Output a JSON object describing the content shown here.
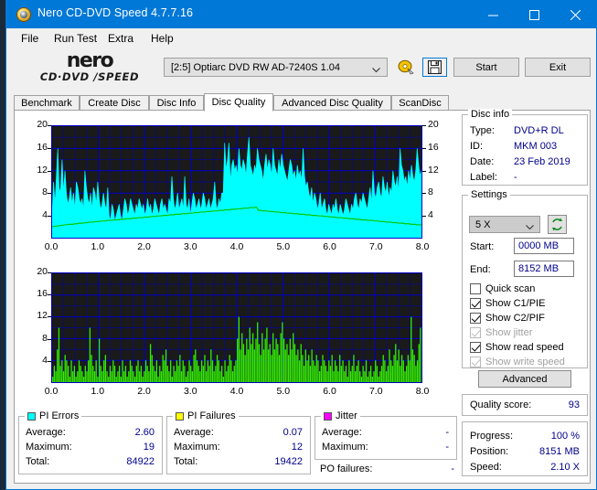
{
  "window": {
    "title": "Nero CD-DVD Speed 4.7.7.16",
    "icon": "nero-disc-icon",
    "minimize": "minimize-icon",
    "maximize": "maximize-icon",
    "close": "close-icon"
  },
  "menu": [
    {
      "label": "File"
    },
    {
      "label": "Run Test"
    },
    {
      "label": "Extra"
    },
    {
      "label": "Help"
    }
  ],
  "logo": {
    "line1": "nero",
    "line2": "CD·DVD ∕SPEED"
  },
  "toolbar": {
    "drive_value": "[2:5]   Optiarc DVD RW AD-7240S 1.04",
    "dropdown_icon": "chevron-down-icon",
    "disc_button_icon": "disc-eject-icon",
    "save_button_icon": "floppy-save-icon",
    "start_label": "Start",
    "exit_label": "Exit"
  },
  "tabs": [
    {
      "label": "Benchmark",
      "active": false
    },
    {
      "label": "Create Disc",
      "active": false
    },
    {
      "label": "Disc Info",
      "active": false
    },
    {
      "label": "Disc Quality",
      "active": true
    },
    {
      "label": "Advanced Disc Quality",
      "active": false
    },
    {
      "label": "ScanDisc",
      "active": false
    }
  ],
  "disc_info": {
    "title": "Disc info",
    "type_label": "Type:",
    "type_value": "DVD+R DL",
    "id_label": "ID:",
    "id_value": "MKM 003",
    "date_label": "Date:",
    "date_value": "23 Feb 2019",
    "label_label": "Label:",
    "label_value": "-"
  },
  "settings": {
    "title": "Settings",
    "speed_value": "5 X",
    "speed_arrow_icon": "chevron-down-icon",
    "refresh_icon": "refresh-arrows-icon",
    "start_label": "Start:",
    "start_value": "0000 MB",
    "end_label": "End:",
    "end_value": "8152 MB",
    "checkboxes": [
      {
        "label": "Quick scan",
        "checked": false,
        "enabled": true
      },
      {
        "label": "Show C1/PIE",
        "checked": true,
        "enabled": true
      },
      {
        "label": "Show C2/PIF",
        "checked": true,
        "enabled": true
      },
      {
        "label": "Show jitter",
        "checked": true,
        "enabled": false
      },
      {
        "label": "Show read speed",
        "checked": true,
        "enabled": true
      },
      {
        "label": "Show write speed",
        "checked": true,
        "enabled": false
      }
    ],
    "advanced_label": "Advanced"
  },
  "quality": {
    "label": "Quality score:",
    "value": "93"
  },
  "progress": {
    "progress_label": "Progress:",
    "progress_value": "100 %",
    "position_label": "Position:",
    "position_value": "8151 MB",
    "speed_label": "Speed:",
    "speed_value": "2.10 X"
  },
  "stats": {
    "pi_errors": {
      "title": "PI Errors",
      "color": "#00ffff",
      "rows": [
        {
          "label": "Average:",
          "value": "2.60"
        },
        {
          "label": "Maximum:",
          "value": "19"
        },
        {
          "label": "Total:",
          "value": "84922"
        }
      ]
    },
    "pi_failures": {
      "title": "PI Failures",
      "color": "#ffff00",
      "rows": [
        {
          "label": "Average:",
          "value": "0.07"
        },
        {
          "label": "Maximum:",
          "value": "12"
        },
        {
          "label": "Total:",
          "value": "19422"
        }
      ]
    },
    "jitter": {
      "title": "Jitter",
      "color": "#ff00ff",
      "rows": [
        {
          "label": "Average:",
          "value": "-"
        },
        {
          "label": "Maximum:",
          "value": "-"
        }
      ],
      "po_label": "PO failures:",
      "po_value": "-"
    }
  },
  "chart_data": [
    {
      "type": "area",
      "name": "pi-errors-chart",
      "title": "PI Errors",
      "xlabel": "",
      "ylabel": "",
      "xlim": [
        0.0,
        8.0
      ],
      "ylim": [
        0,
        20
      ],
      "grid": true,
      "background": "#1a1a1a",
      "gridcolor": "#0000c8",
      "xticks": [
        "0.0",
        "1.0",
        "2.0",
        "3.0",
        "4.0",
        "5.0",
        "6.0",
        "7.0",
        "8.0"
      ],
      "yticks": [
        "4",
        "8",
        "12",
        "16",
        "20"
      ],
      "yticks_right": [
        "4",
        "8",
        "12",
        "16",
        "20"
      ],
      "series": [
        {
          "name": "PI Errors",
          "color": "#00ffff",
          "kind": "area",
          "values": [
            4,
            10,
            6,
            11,
            16,
            8,
            9,
            14,
            8,
            12,
            8,
            6,
            7,
            9,
            6,
            8,
            5,
            10,
            9,
            7,
            6,
            7,
            5,
            12,
            9,
            7,
            6,
            8,
            5,
            9,
            8,
            6,
            10,
            7,
            5,
            6,
            8,
            6,
            5,
            9,
            4,
            3,
            6,
            5,
            3,
            4,
            5,
            6,
            4,
            3,
            5,
            7,
            6,
            4,
            5,
            7,
            6,
            5,
            4,
            6,
            5,
            7,
            6,
            5,
            6,
            4,
            5,
            7,
            5,
            6,
            4,
            5,
            7,
            6,
            5,
            4,
            6,
            7,
            5,
            6,
            5,
            4,
            7,
            6,
            11,
            7,
            5,
            6,
            8,
            5,
            6,
            7,
            5,
            11,
            6,
            5,
            7,
            4,
            6,
            8,
            7,
            5,
            6,
            7,
            5,
            6,
            8,
            7,
            5,
            6,
            7,
            5,
            6,
            7,
            10,
            6,
            5,
            7,
            6,
            8,
            8,
            17,
            12,
            14,
            17,
            10,
            13,
            14,
            12,
            13,
            11,
            16,
            13,
            12,
            14,
            13,
            11,
            15,
            18,
            13,
            12,
            11,
            13,
            12,
            16,
            14,
            13,
            12,
            10,
            13,
            15,
            12,
            14,
            13,
            11,
            16,
            13,
            12,
            11,
            14,
            12,
            15,
            13,
            12,
            11,
            10,
            12,
            14,
            13,
            11,
            12,
            10,
            13,
            11,
            12,
            10,
            16,
            11,
            9,
            10,
            8,
            7,
            9,
            6,
            8,
            7,
            5,
            6,
            8,
            5,
            6,
            7,
            5,
            4,
            6,
            5,
            4,
            6,
            5,
            7,
            5,
            4,
            6,
            5,
            4,
            5,
            7,
            6,
            5,
            4,
            6,
            5,
            7,
            8,
            6,
            5,
            7,
            6,
            8,
            7,
            6,
            5,
            7,
            9,
            6,
            12,
            8,
            7,
            9,
            10,
            8,
            7,
            11,
            9,
            8,
            10,
            7,
            9,
            8,
            12,
            10,
            9,
            11,
            8,
            16,
            13,
            12,
            10,
            11,
            9,
            12,
            10,
            13,
            11,
            10,
            12,
            16,
            13,
            11,
            12
          ]
        },
        {
          "name": "read speed",
          "color": "#00c800",
          "kind": "line",
          "values": [
            2.0,
            2.0,
            2.1,
            2.1,
            2.2,
            2.2,
            2.3,
            2.3,
            2.4,
            2.4,
            2.4,
            2.5,
            2.5,
            2.6,
            2.6,
            2.6,
            2.7,
            2.7,
            2.8,
            2.8,
            2.8,
            2.9,
            2.9,
            2.9,
            3.0,
            3.0,
            3.0,
            3.1,
            3.1,
            3.1,
            3.2,
            3.2,
            3.2,
            3.3,
            3.3,
            3.3,
            3.4,
            3.4,
            3.4,
            3.5,
            3.5,
            3.5,
            3.6,
            3.6,
            3.6,
            3.7,
            3.7,
            3.7,
            3.8,
            3.8,
            3.8,
            3.9,
            3.9,
            3.9,
            4.0,
            4.0,
            4.0,
            4.1,
            4.1,
            4.1,
            4.2,
            4.2,
            4.2,
            4.3,
            4.3,
            4.3,
            4.4,
            4.4,
            4.4,
            4.5,
            4.5,
            4.5,
            4.6,
            4.6,
            4.6,
            4.7,
            4.7,
            4.7,
            4.8,
            4.8,
            4.8,
            4.9,
            4.9,
            4.9,
            5.0,
            5.0,
            5.0,
            5.1,
            5.1,
            5.1,
            5.2,
            5.2,
            5.2,
            5.3,
            5.3,
            5.3,
            5.4,
            5.4,
            5.4,
            5.5,
            4.9,
            4.9,
            4.8,
            4.8,
            4.8,
            4.7,
            4.7,
            4.7,
            4.6,
            4.6,
            4.6,
            4.5,
            4.5,
            4.5,
            4.4,
            4.4,
            4.4,
            4.3,
            4.3,
            4.3,
            4.2,
            4.2,
            4.2,
            4.1,
            4.1,
            4.1,
            4.0,
            4.0,
            4.0,
            3.9,
            3.9,
            3.9,
            3.8,
            3.8,
            3.8,
            3.7,
            3.7,
            3.7,
            3.6,
            3.6,
            3.6,
            3.5,
            3.5,
            3.5,
            3.4,
            3.4,
            3.4,
            3.3,
            3.3,
            3.3,
            3.2,
            3.2,
            3.2,
            3.1,
            3.1,
            3.1,
            3.0,
            3.0,
            3.0,
            2.9,
            2.9,
            2.9,
            2.8,
            2.8,
            2.8,
            2.7,
            2.7,
            2.7,
            2.6,
            2.6,
            2.6,
            2.5,
            2.5,
            2.5,
            2.4,
            2.4,
            2.4,
            2.3,
            2.3,
            2.3
          ]
        }
      ]
    },
    {
      "type": "bar",
      "name": "pi-failures-chart",
      "title": "PI Failures",
      "xlabel": "",
      "ylabel": "",
      "xlim": [
        0.0,
        8.0
      ],
      "ylim": [
        0,
        20
      ],
      "grid": true,
      "background": "#000000",
      "gridcolor": "#0000c8",
      "xticks": [
        "0.0",
        "1.0",
        "2.0",
        "3.0",
        "4.0",
        "5.0",
        "6.0",
        "7.0",
        "8.0"
      ],
      "yticks": [
        "4",
        "8",
        "12",
        "16",
        "20"
      ],
      "series": [
        {
          "name": "PI Failures",
          "color": "#33ee00",
          "kind": "bar",
          "values": [
            1,
            3,
            2,
            6,
            10,
            3,
            4,
            2,
            5,
            4,
            3,
            1,
            4,
            2,
            3,
            1,
            2,
            4,
            3,
            2,
            1,
            3,
            2,
            4,
            10,
            5,
            3,
            2,
            4,
            1,
            8,
            3,
            2,
            4,
            5,
            2,
            1,
            3,
            2,
            4,
            3,
            1,
            2,
            3,
            1,
            4,
            2,
            3,
            1,
            2,
            4,
            3,
            2,
            1,
            3,
            4,
            2,
            3,
            1,
            2,
            4,
            3,
            2,
            7,
            5,
            3,
            2,
            4,
            1,
            3,
            2,
            5,
            4,
            6,
            3,
            2,
            4,
            1,
            3,
            2,
            4,
            3,
            5,
            2,
            4,
            3,
            1,
            2,
            4,
            3,
            2,
            5,
            6,
            4,
            3,
            2,
            4,
            3,
            5,
            2,
            4,
            3,
            6,
            4,
            2,
            3,
            5,
            4,
            2,
            3,
            1,
            4,
            2,
            3,
            5,
            4,
            2,
            3,
            4,
            8,
            12,
            6,
            9,
            7,
            5,
            8,
            6,
            10,
            7,
            9,
            6,
            8,
            11,
            7,
            5,
            9,
            6,
            8,
            10,
            6,
            7,
            5,
            9,
            6,
            8,
            7,
            5,
            9,
            11,
            8,
            6,
            7,
            5,
            8,
            6,
            9,
            7,
            5,
            6,
            4,
            7,
            5,
            3,
            6,
            4,
            5,
            3,
            6,
            4,
            3,
            5,
            4,
            2,
            3,
            5,
            4,
            3,
            2,
            4,
            3,
            5,
            2,
            4,
            3,
            2,
            5,
            3,
            4,
            2,
            3,
            1,
            4,
            2,
            3,
            5,
            2,
            3,
            4,
            2,
            1,
            3,
            2,
            4,
            1,
            2,
            3,
            1,
            2,
            4,
            3,
            1,
            2,
            3,
            5,
            4,
            2,
            3,
            6,
            4,
            3,
            5,
            7,
            4,
            6,
            3,
            5,
            4,
            2,
            3,
            5,
            4,
            12,
            6,
            5,
            3,
            4,
            7,
            10
          ]
        }
      ]
    }
  ]
}
